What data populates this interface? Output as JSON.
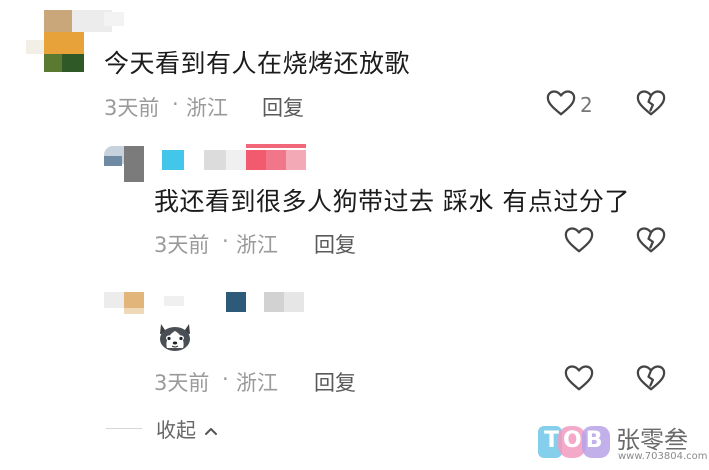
{
  "comments": [
    {
      "text": "今天看到有人在烧烤还放歌",
      "time": "3天前",
      "location": "浙江",
      "reply_label": "回复",
      "like_count": "2"
    },
    {
      "text": "我还看到很多人狗带过去 踩水 有点过分了",
      "time": "3天前",
      "location": "浙江",
      "reply_label": "回复"
    },
    {
      "time": "3天前",
      "location": "浙江",
      "reply_label": "回复",
      "sticker": "husky-emoji"
    }
  ],
  "collapse_label": "收起",
  "separator": "·",
  "watermark": {
    "brand": "张零叁",
    "url": "www.703804.com",
    "logo": "TOB"
  },
  "colors": {
    "text": "#1c1c1c",
    "meta": "#9a9a9a",
    "icon": "#444444"
  }
}
